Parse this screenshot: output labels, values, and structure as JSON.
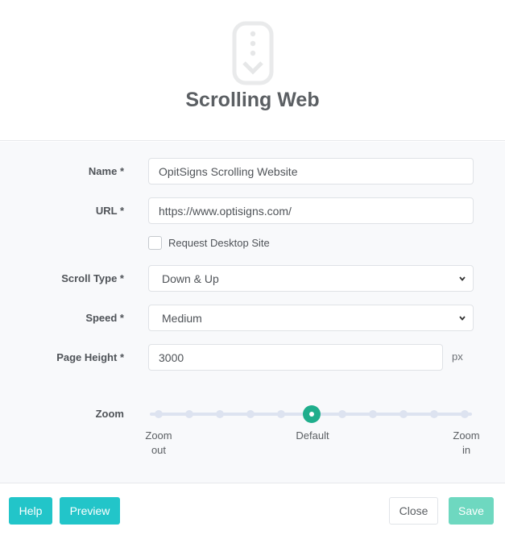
{
  "header": {
    "icon": "scroll-down-phone-icon",
    "title": "Scrolling Web"
  },
  "form": {
    "name": {
      "label": "Name *",
      "value": "OpitSigns Scrolling Website"
    },
    "url": {
      "label": "URL *",
      "value": "https://www.optisigns.com/"
    },
    "desktop_site": {
      "label": "Request Desktop Site",
      "checked": false
    },
    "scroll_type": {
      "label": "Scroll Type *",
      "value": "Down & Up"
    },
    "speed": {
      "label": "Speed *",
      "value": "Medium"
    },
    "page_height": {
      "label": "Page Height *",
      "value": "3000",
      "unit": "px"
    },
    "zoom": {
      "label": "Zoom",
      "steps": 11,
      "selected_index": 5,
      "min_label_line1": "Zoom",
      "min_label_line2": "out",
      "mid_label": "Default",
      "max_label_line1": "Zoom",
      "max_label_line2": "in"
    }
  },
  "footer": {
    "help_label": "Help",
    "preview_label": "Preview",
    "close_label": "Close",
    "save_label": "Save"
  },
  "colors": {
    "accent_teal": "#22c5c9",
    "slider_handle": "#1fae8c",
    "save_disabled": "#6ed8c0"
  }
}
